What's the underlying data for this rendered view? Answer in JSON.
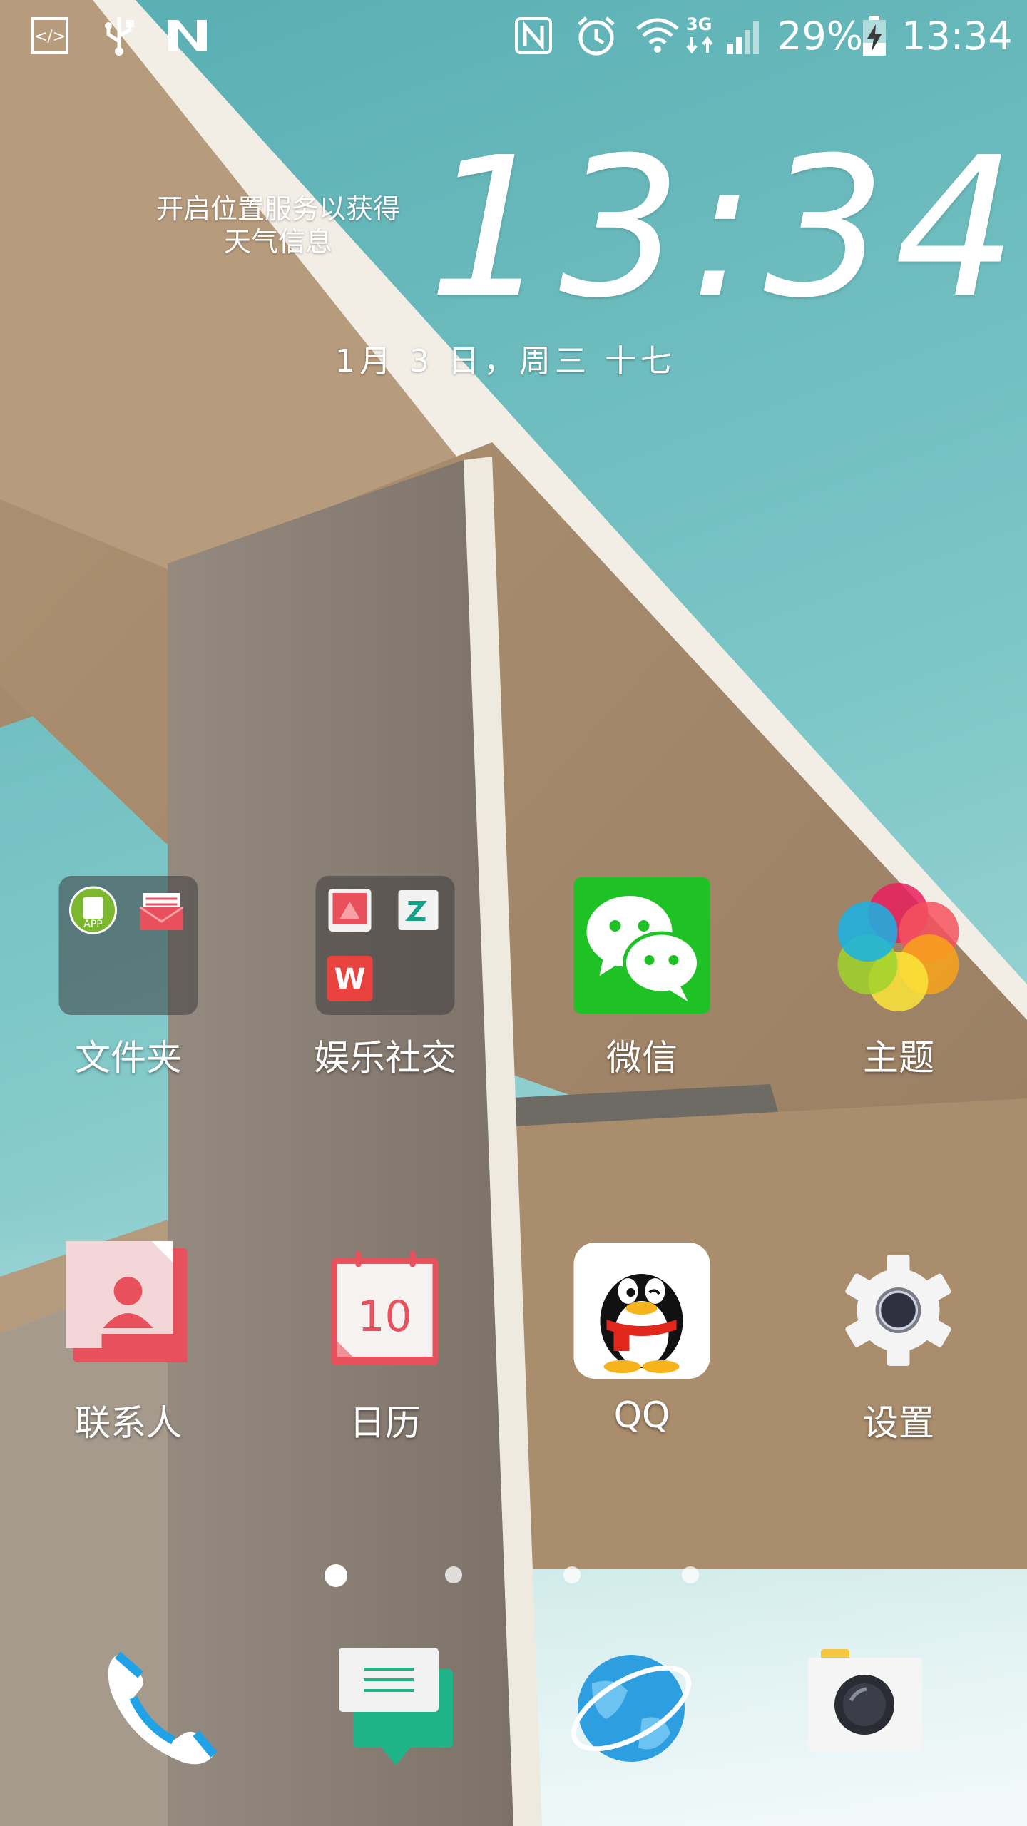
{
  "status_bar": {
    "left_icons": [
      "developer-code-icon",
      "usb-icon",
      "n-notification-icon"
    ],
    "right_icons": [
      "nfc-icon",
      "alarm-icon",
      "wifi-icon",
      "3g-data-icon",
      "signal-icon",
      "battery-charging-icon"
    ],
    "network_type": "3G",
    "battery_percent": "29%",
    "time": "13:34"
  },
  "clock_widget": {
    "weather_message_line1": "开启位置服务以获得",
    "weather_message_line2": "天气信息",
    "time": "13:34",
    "date": "1月 3 日，周三 十七"
  },
  "apps": [
    {
      "label": "文件夹",
      "icon": "folder-icon"
    },
    {
      "label": "娱乐社交",
      "icon": "folder-icon"
    },
    {
      "label": "微信",
      "icon": "wechat-icon"
    },
    {
      "label": "主题",
      "icon": "themes-icon"
    },
    {
      "label": "联系人",
      "icon": "contacts-icon"
    },
    {
      "label": "日历",
      "icon": "calendar-icon",
      "calendar_day": "10"
    },
    {
      "label": "QQ",
      "icon": "qq-icon"
    },
    {
      "label": "设置",
      "icon": "settings-icon"
    }
  ],
  "folder_1_contents": [
    "app-store-icon",
    "mail-icon"
  ],
  "folder_2_contents": [
    "gallery-icon",
    "zhihu-icon",
    "wps-icon"
  ],
  "wps_letter": "W",
  "app_store_badge": "APP",
  "page_indicator": {
    "pages": 4,
    "current": 1
  },
  "dock": [
    "phone-icon",
    "messages-icon",
    "browser-icon",
    "camera-icon"
  ],
  "colors": {
    "wechat_green": "#1fc224",
    "calendar_red": "#e8505b",
    "sky": "#7cc6c7",
    "concrete": "#8c7f72"
  }
}
